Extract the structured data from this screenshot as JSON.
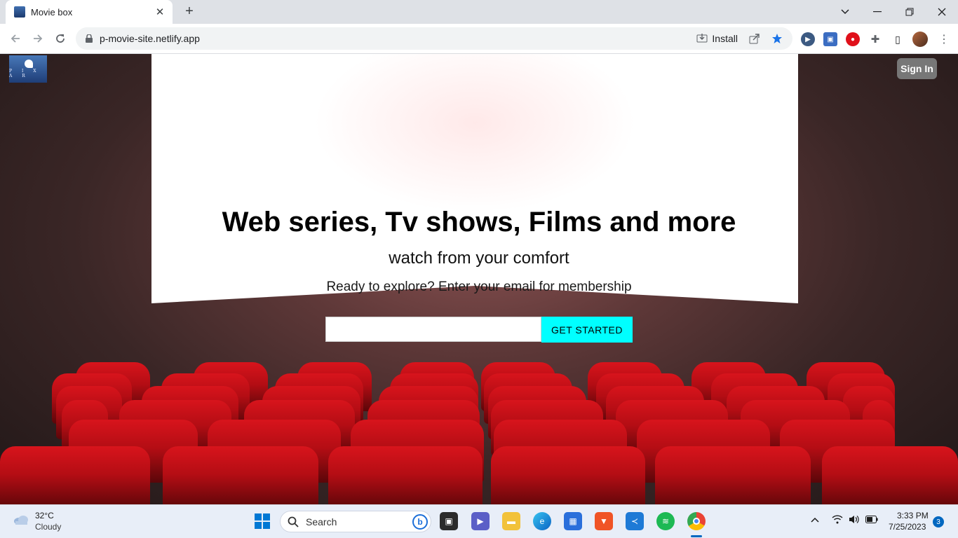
{
  "browser": {
    "tab_title": "Movie box",
    "url": "p-movie-site.netlify.app",
    "install_label": "Install"
  },
  "site": {
    "signin_label": "Sign In",
    "logo_text": "P I X A R",
    "hero_title": "Web series, Tv shows, Films and more",
    "hero_subtitle": "watch from your comfort",
    "hero_cta": "Ready to explore? Enter your email for membership",
    "email_placeholder": "",
    "get_started_label": "GET STARTED"
  },
  "taskbar": {
    "weather_temp": "32°C",
    "weather_desc": "Cloudy",
    "search_label": "Search",
    "clock_time": "3:33 PM",
    "clock_date": "7/25/2023",
    "notification_count": "3"
  },
  "colors": {
    "accent_button": "#00ffff",
    "seat_red": "#c8101a",
    "signin_bg": "#777777"
  }
}
